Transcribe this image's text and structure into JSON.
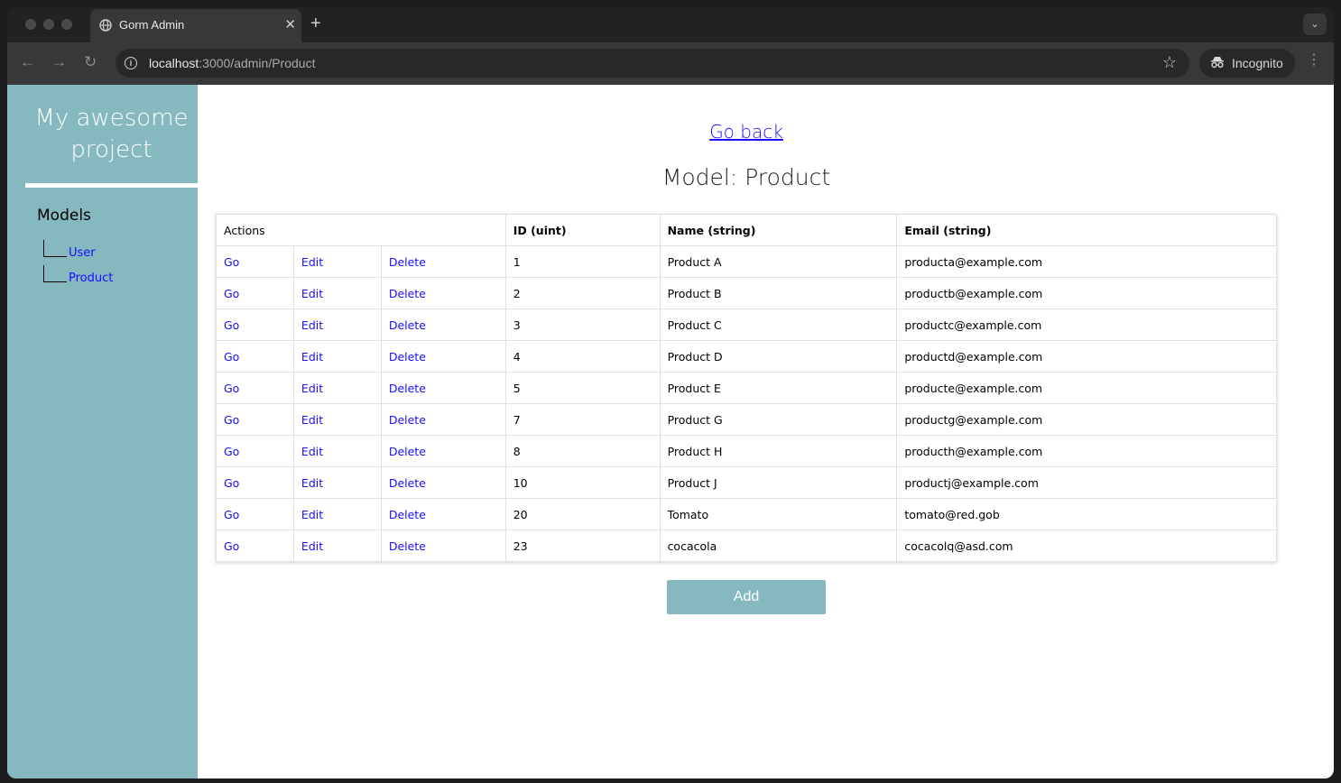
{
  "browser": {
    "tab_title": "Gorm Admin",
    "url_host": "localhost",
    "url_path": ":3000/admin/Product",
    "incognito_label": "Incognito"
  },
  "sidebar": {
    "brand": "My awesome project",
    "models_heading": "Models",
    "items": [
      {
        "label": "User"
      },
      {
        "label": "Product"
      }
    ]
  },
  "main": {
    "go_back": "Go back",
    "title": "Model: Product",
    "add_label": "Add"
  },
  "table": {
    "headers": [
      "Actions",
      "ID (uint)",
      "Name (string)",
      "Email (string)"
    ],
    "action_labels": {
      "go": "Go",
      "edit": "Edit",
      "delete": "Delete"
    },
    "rows": [
      {
        "id": "1",
        "name": "Product A",
        "email": "producta@example.com"
      },
      {
        "id": "2",
        "name": "Product B",
        "email": "productb@example.com"
      },
      {
        "id": "3",
        "name": "Product C",
        "email": "productc@example.com"
      },
      {
        "id": "4",
        "name": "Product D",
        "email": "productd@example.com"
      },
      {
        "id": "5",
        "name": "Product E",
        "email": "producte@example.com"
      },
      {
        "id": "7",
        "name": "Product G",
        "email": "productg@example.com"
      },
      {
        "id": "8",
        "name": "Product H",
        "email": "producth@example.com"
      },
      {
        "id": "10",
        "name": "Product J",
        "email": "productj@example.com"
      },
      {
        "id": "20",
        "name": "Tomato",
        "email": "tomato@red.gob"
      },
      {
        "id": "23",
        "name": "cocacola",
        "email": "cocacolq@asd.com"
      }
    ]
  },
  "colors": {
    "sidebar_bg": "#85b9bf",
    "link": "#1a0dff"
  }
}
